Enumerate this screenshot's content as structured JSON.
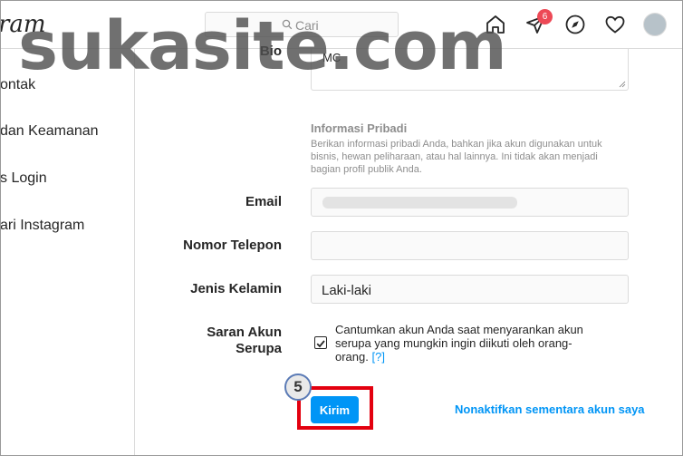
{
  "nav": {
    "brand": "ram",
    "search_placeholder": "Cari",
    "notification_count": "6",
    "icons": [
      "home-icon",
      "direct-icon",
      "explore-icon",
      "heart-icon"
    ]
  },
  "sidebar": {
    "items": [
      {
        "label": "ontak"
      },
      {
        "label": "dan Keamanan"
      },
      {
        "label": "s Login"
      },
      {
        "label": "ari Instagram"
      }
    ]
  },
  "form": {
    "bio_label": "Bio",
    "bio_value": "MC",
    "personal_info_title": "Informasi Pribadi",
    "personal_info_desc": "Berikan informasi pribadi Anda, bahkan jika akun digunakan untuk bisnis, hewan peliharaan, atau hal lainnya. Ini tidak akan menjadi bagian profil publik Anda.",
    "email_label": "Email",
    "email_value": "",
    "phone_label": "Nomor Telepon",
    "phone_value": "",
    "gender_label": "Jenis Kelamin",
    "gender_value": "Laki-laki",
    "suggest_label_line1": "Saran Akun",
    "suggest_label_line2": "Serupa",
    "suggest_checked": true,
    "suggest_text": "Cantumkan akun Anda saat menyarankan akun serupa yang mungkin ingin diikuti oleh orang-orang.",
    "help_link": "[?]",
    "submit_label": "Kirim",
    "deactivate_label": "Nonaktifkan sementara akun saya"
  },
  "annotation": {
    "step_number": "5",
    "highlight_color": "#e3000f"
  },
  "watermark": "sukasite.com",
  "colors": {
    "accent": "#0095f6",
    "badge": "#ed4956"
  }
}
